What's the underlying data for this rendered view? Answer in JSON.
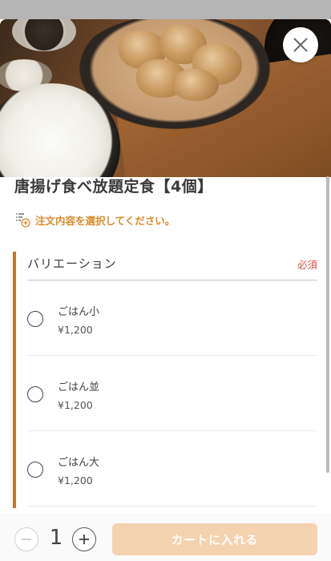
{
  "product": {
    "title": "唐揚げ食べ放題定食【4個】",
    "image_icon": "fried-chicken-photo"
  },
  "prompt": {
    "text": "注文内容を選択してください。",
    "icon": "list-add-icon"
  },
  "variation": {
    "title": "バリエーション",
    "required_label": "必須",
    "options": [
      {
        "name": "ごはん小",
        "price": "¥1,200",
        "selected": false
      },
      {
        "name": "ごはん並",
        "price": "¥1,200",
        "selected": false
      },
      {
        "name": "ごはん大",
        "price": "¥1,200",
        "selected": false
      }
    ]
  },
  "footer": {
    "quantity": "1",
    "cart_button_label": "カートに入れる"
  },
  "colors": {
    "accent": "#c6742a",
    "prompt": "#d98a2b",
    "required": "#d9544a",
    "cart_button": "#f5d2b0"
  },
  "icons": {
    "close": "close-icon",
    "minus": "minus-icon",
    "plus": "plus-icon"
  }
}
